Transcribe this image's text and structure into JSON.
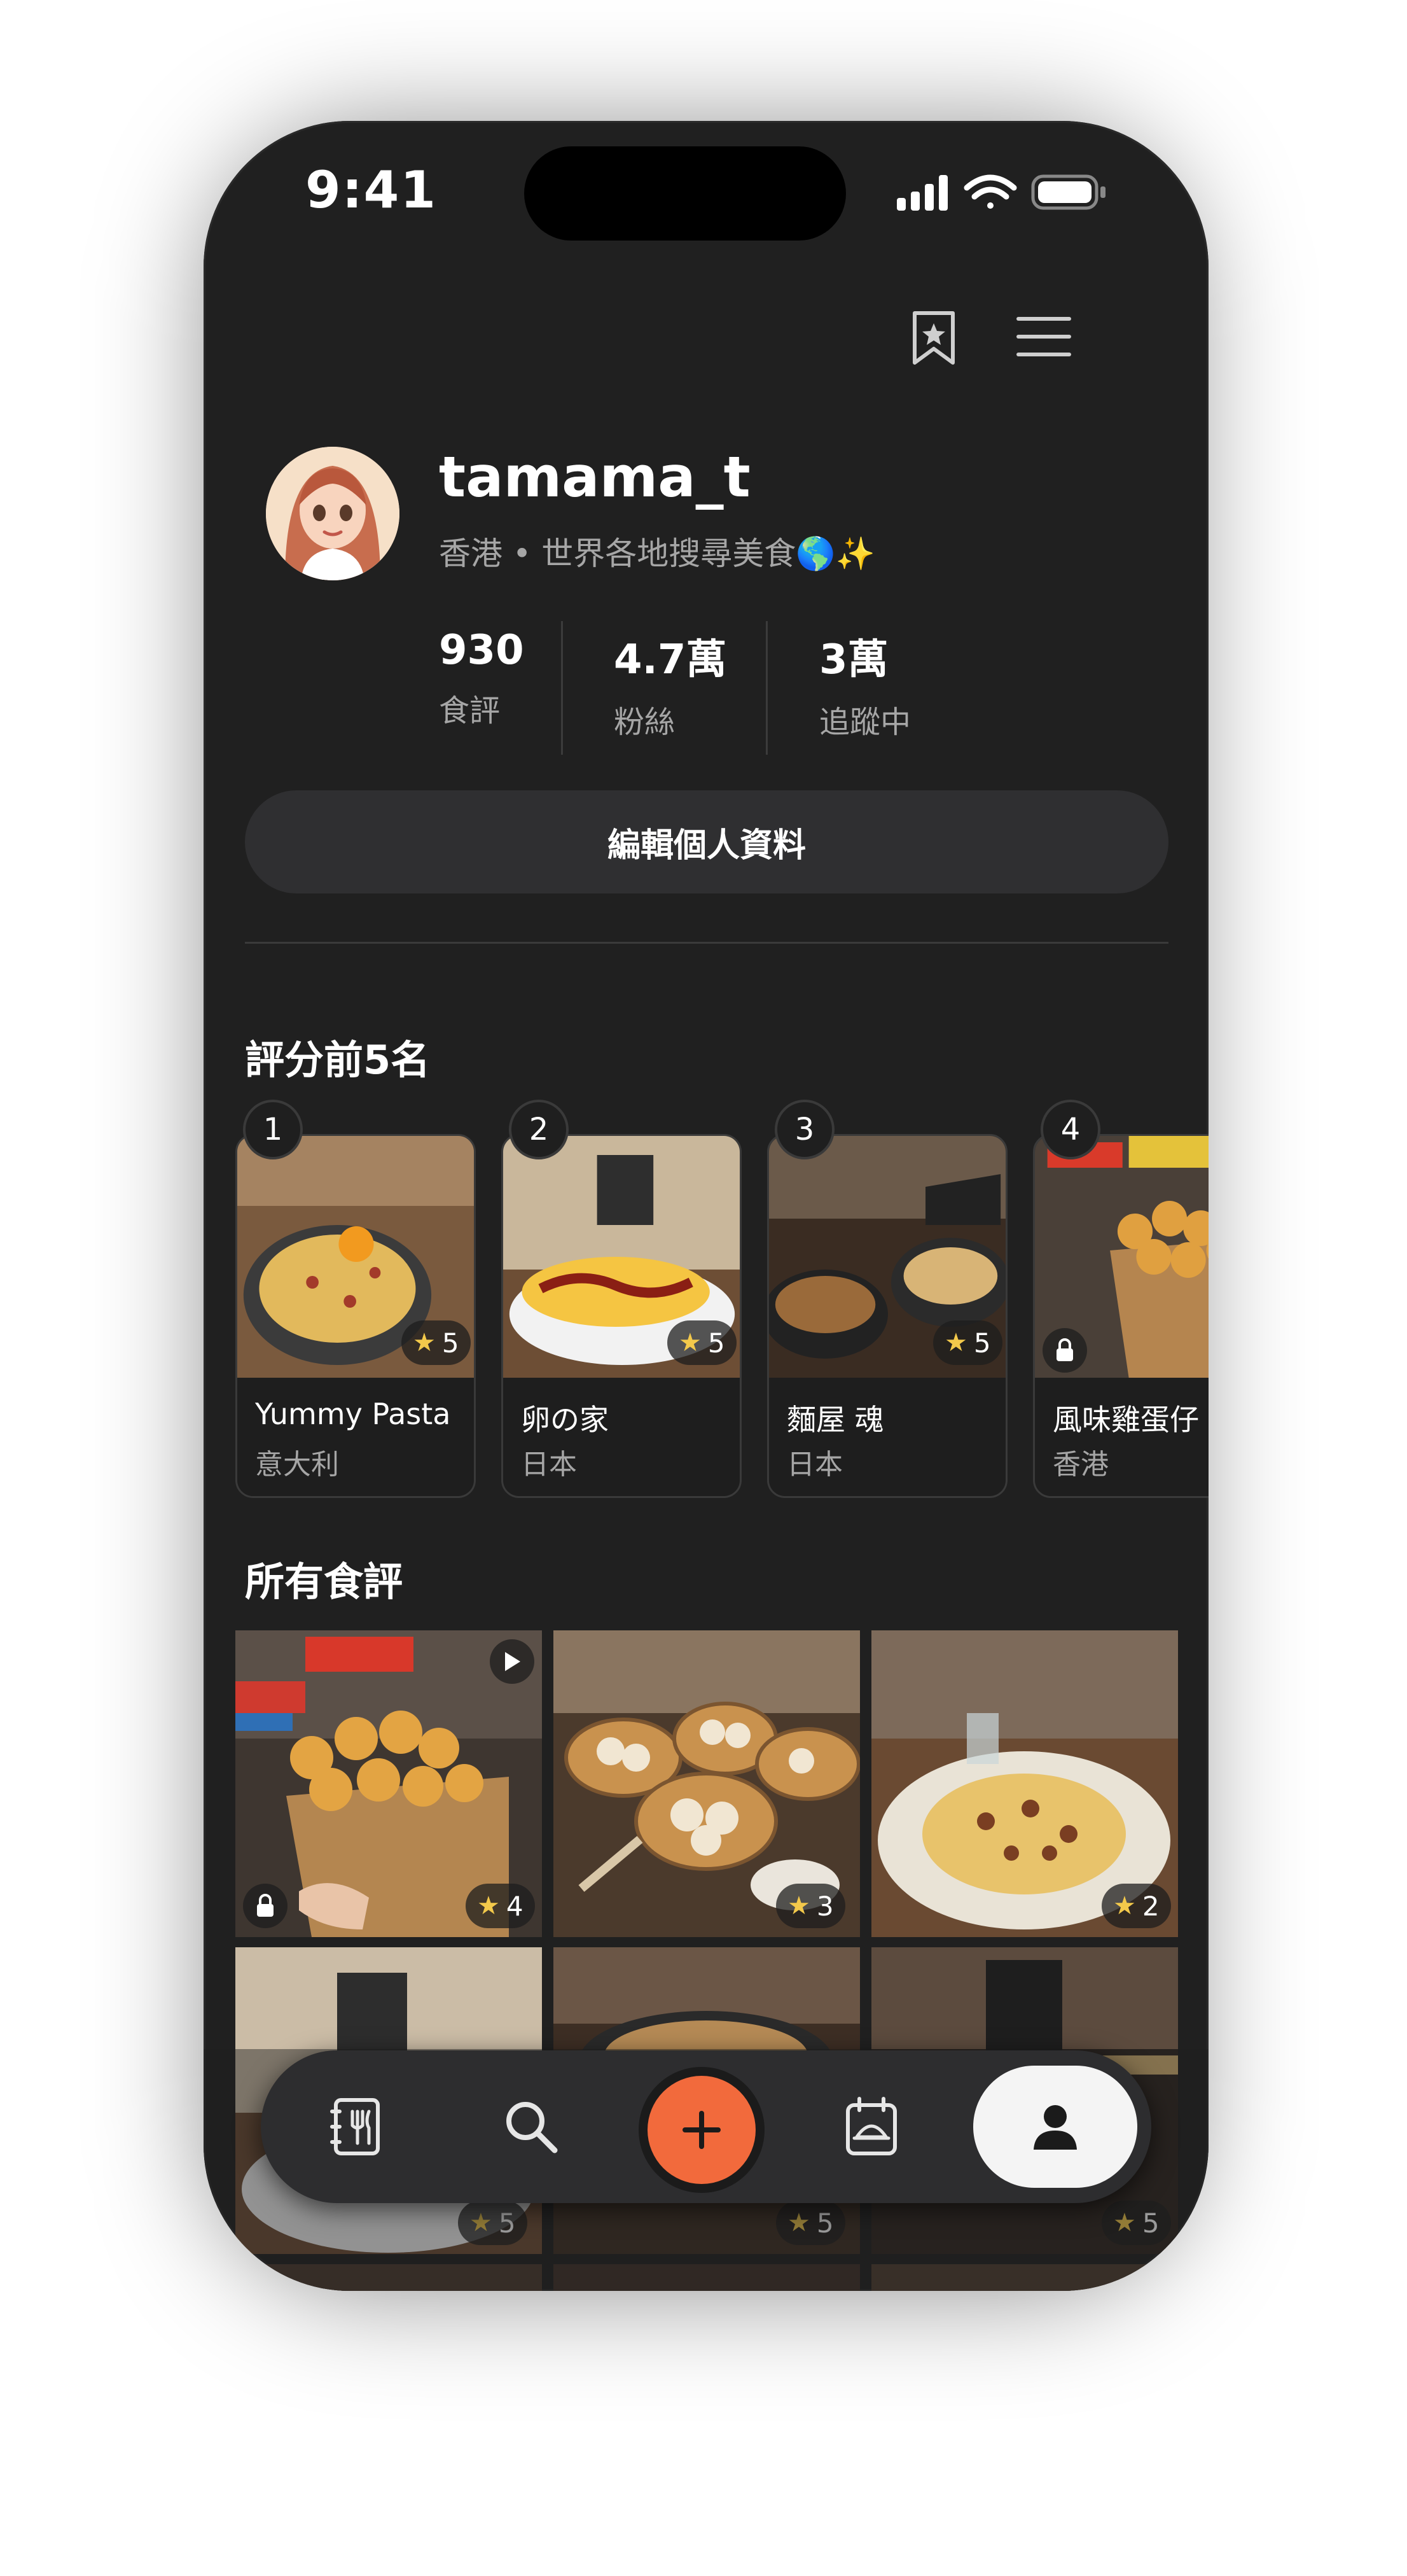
{
  "status_bar": {
    "time": "9:41"
  },
  "profile": {
    "username": "tamama_t",
    "bio": "香港 • 世界各地搜尋美食🌎✨",
    "stats": [
      {
        "value": "930",
        "label": "食評"
      },
      {
        "value": "4.7萬",
        "label": "粉絲"
      },
      {
        "value": "3萬",
        "label": "追蹤中"
      }
    ],
    "edit_label": "編輯個人資料"
  },
  "top5": {
    "title": "評分前5名",
    "items": [
      {
        "rank": "1",
        "name": "Yummy Pasta",
        "country": "意大利",
        "rating": "5"
      },
      {
        "rank": "2",
        "name": "卵の家",
        "country": "日本",
        "rating": "5"
      },
      {
        "rank": "3",
        "name": "麵屋 魂",
        "country": "日本",
        "rating": "5"
      },
      {
        "rank": "4",
        "name": "風味雞蛋仔",
        "country": "香港",
        "rating": ""
      }
    ]
  },
  "all_reviews": {
    "title": "所有食評",
    "tiles": [
      {
        "rating": "4",
        "kind": "egg-waffle"
      },
      {
        "rating": "3",
        "kind": "dim-sum"
      },
      {
        "rating": "2",
        "kind": "pasta"
      },
      {
        "rating": "5",
        "kind": "omelette-rice"
      },
      {
        "rating": "5",
        "kind": "ramen"
      },
      {
        "rating": "5",
        "kind": "noodle-shop"
      }
    ]
  },
  "icons": {
    "bookmark": "bookmark-star-icon",
    "menu": "hamburger-menu-icon",
    "tabs": [
      "menu-book-icon",
      "search-icon",
      "add-icon",
      "calendar-icon",
      "profile-icon"
    ]
  },
  "colors": {
    "background": "#202020",
    "accent": "#f26a3c",
    "star": "#f3c94b"
  }
}
